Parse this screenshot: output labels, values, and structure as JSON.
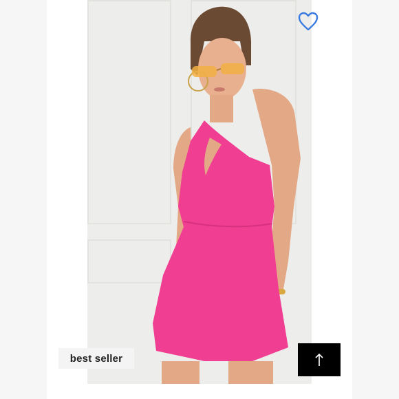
{
  "listing": {
    "badge_label": "best seller"
  },
  "icons": {
    "like": "heart-icon",
    "scroll_top": "arrow-up-icon"
  },
  "colors": {
    "heart": "#3a7be0",
    "dress": "#f03e93",
    "button_bg": "#000000"
  }
}
